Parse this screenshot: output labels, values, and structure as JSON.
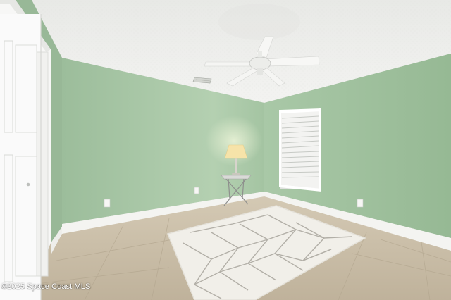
{
  "scene": {
    "description_free": true,
    "watermark": "©2025 Space Coast MLS",
    "colors": {
      "ceiling": "#eeefec",
      "wall_left": "#9dbf9c",
      "wall_back": "#a6c6a4",
      "wall_right": "#9fc19d",
      "wall_far_left": "#98b897",
      "baseboard": "#f4f4f1",
      "floor": "#cbbfa9",
      "closet_door": "#fafafa",
      "rug": "#f1efe9",
      "rug_pattern": "#a8a49c",
      "lamp_shade": "#f6e3a9",
      "window_blinds": "#f3f3f1"
    }
  }
}
